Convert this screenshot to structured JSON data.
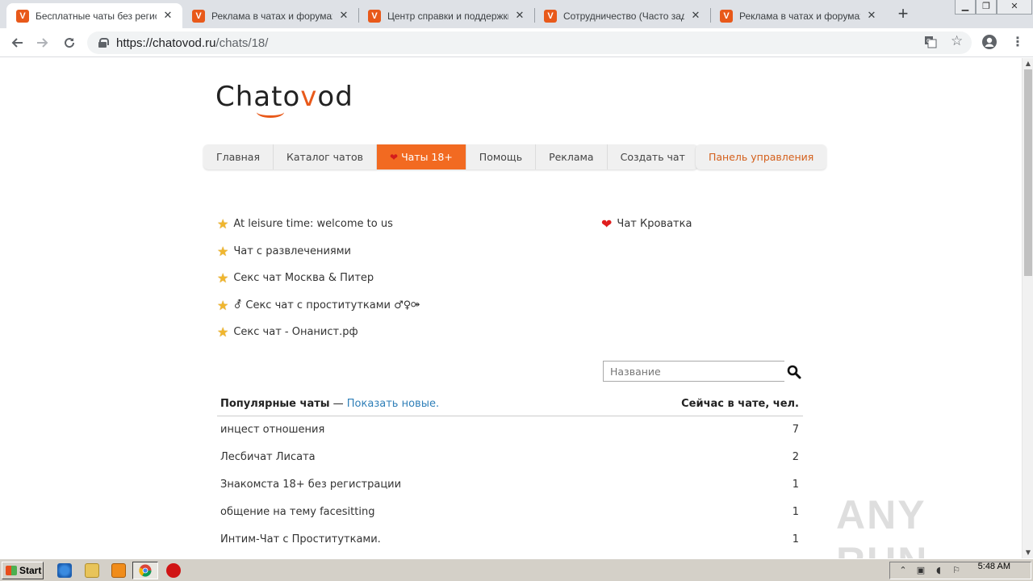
{
  "browser": {
    "tabs": [
      {
        "title": "Бесплатные чаты без регистрации",
        "active": true
      },
      {
        "title": "Реклама в чатах и форумах - Chatovod",
        "active": false
      },
      {
        "title": "Центр справки и поддержки Chatovod",
        "active": false
      },
      {
        "title": "Сотрудничество (Часто задаваемые вопросы)",
        "active": false
      },
      {
        "title": "Реклама в чатах и форумах - Chatovod",
        "active": false
      }
    ],
    "url_host": "https://chatovod.ru",
    "url_path": "/chats/18/"
  },
  "site": {
    "logo_pre": "Chato",
    "logo_v": "v",
    "logo_post": "od",
    "menu": [
      {
        "label": "Главная"
      },
      {
        "label": "Каталог чатов"
      },
      {
        "label": "Чаты 18+",
        "active": true
      },
      {
        "label": "Помощь"
      },
      {
        "label": "Реклама"
      },
      {
        "label": "Создать чат"
      }
    ],
    "panel_label": "Панель управления",
    "featured": [
      "At leisure time: welcome to us",
      "Чат с развлечениями",
      "Секс чат Москва & Питер",
      "⚦ Секс чат с проститутками ♂♀⚩",
      "Секс чат - Онанист.рф"
    ],
    "featured_right": "Чат Кроватка",
    "search_placeholder": "Название",
    "table": {
      "popular_label": "Популярные чаты",
      "dash": " — ",
      "show_new": "Показать новые.",
      "right_header": "Сейчас в чате, чел."
    },
    "rows": [
      {
        "name": "инцест отношения",
        "count": "7"
      },
      {
        "name": "Лесбичат Лисата",
        "count": "2"
      },
      {
        "name": "Знакомста 18+ без регистрации",
        "count": "1"
      },
      {
        "name": "общение на тему facesitting",
        "count": "1"
      },
      {
        "name": "Интим-Чат с Проститутками.",
        "count": "1"
      }
    ]
  },
  "watermark": "ANY RUN",
  "taskbar": {
    "start_label": "Start",
    "clock": "5:48 AM"
  },
  "colors": {
    "accent": "#f26a21",
    "brand": "#e8591a",
    "link": "#2f7fb8"
  }
}
